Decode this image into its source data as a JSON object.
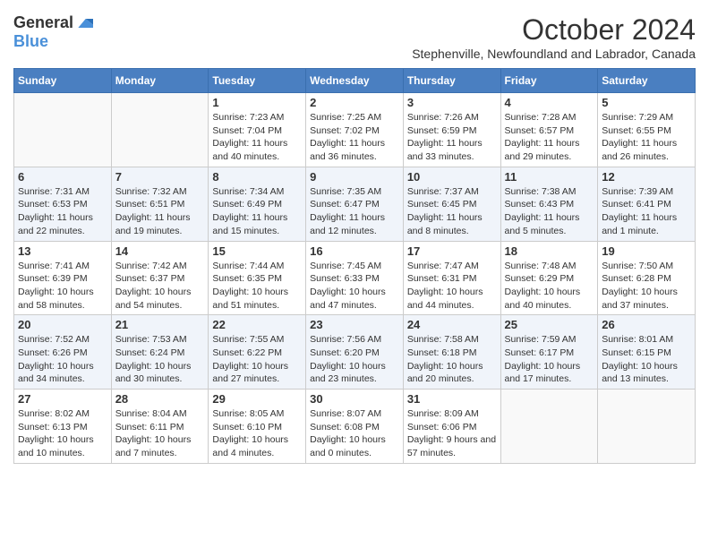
{
  "logo": {
    "general": "General",
    "blue": "Blue"
  },
  "title": "October 2024",
  "subtitle": "Stephenville, Newfoundland and Labrador, Canada",
  "weekdays": [
    "Sunday",
    "Monday",
    "Tuesday",
    "Wednesday",
    "Thursday",
    "Friday",
    "Saturday"
  ],
  "weeks": [
    [
      {
        "day": "",
        "sunrise": "",
        "sunset": "",
        "daylight": ""
      },
      {
        "day": "",
        "sunrise": "",
        "sunset": "",
        "daylight": ""
      },
      {
        "day": "1",
        "sunrise": "Sunrise: 7:23 AM",
        "sunset": "Sunset: 7:04 PM",
        "daylight": "Daylight: 11 hours and 40 minutes."
      },
      {
        "day": "2",
        "sunrise": "Sunrise: 7:25 AM",
        "sunset": "Sunset: 7:02 PM",
        "daylight": "Daylight: 11 hours and 36 minutes."
      },
      {
        "day": "3",
        "sunrise": "Sunrise: 7:26 AM",
        "sunset": "Sunset: 6:59 PM",
        "daylight": "Daylight: 11 hours and 33 minutes."
      },
      {
        "day": "4",
        "sunrise": "Sunrise: 7:28 AM",
        "sunset": "Sunset: 6:57 PM",
        "daylight": "Daylight: 11 hours and 29 minutes."
      },
      {
        "day": "5",
        "sunrise": "Sunrise: 7:29 AM",
        "sunset": "Sunset: 6:55 PM",
        "daylight": "Daylight: 11 hours and 26 minutes."
      }
    ],
    [
      {
        "day": "6",
        "sunrise": "Sunrise: 7:31 AM",
        "sunset": "Sunset: 6:53 PM",
        "daylight": "Daylight: 11 hours and 22 minutes."
      },
      {
        "day": "7",
        "sunrise": "Sunrise: 7:32 AM",
        "sunset": "Sunset: 6:51 PM",
        "daylight": "Daylight: 11 hours and 19 minutes."
      },
      {
        "day": "8",
        "sunrise": "Sunrise: 7:34 AM",
        "sunset": "Sunset: 6:49 PM",
        "daylight": "Daylight: 11 hours and 15 minutes."
      },
      {
        "day": "9",
        "sunrise": "Sunrise: 7:35 AM",
        "sunset": "Sunset: 6:47 PM",
        "daylight": "Daylight: 11 hours and 12 minutes."
      },
      {
        "day": "10",
        "sunrise": "Sunrise: 7:37 AM",
        "sunset": "Sunset: 6:45 PM",
        "daylight": "Daylight: 11 hours and 8 minutes."
      },
      {
        "day": "11",
        "sunrise": "Sunrise: 7:38 AM",
        "sunset": "Sunset: 6:43 PM",
        "daylight": "Daylight: 11 hours and 5 minutes."
      },
      {
        "day": "12",
        "sunrise": "Sunrise: 7:39 AM",
        "sunset": "Sunset: 6:41 PM",
        "daylight": "Daylight: 11 hours and 1 minute."
      }
    ],
    [
      {
        "day": "13",
        "sunrise": "Sunrise: 7:41 AM",
        "sunset": "Sunset: 6:39 PM",
        "daylight": "Daylight: 10 hours and 58 minutes."
      },
      {
        "day": "14",
        "sunrise": "Sunrise: 7:42 AM",
        "sunset": "Sunset: 6:37 PM",
        "daylight": "Daylight: 10 hours and 54 minutes."
      },
      {
        "day": "15",
        "sunrise": "Sunrise: 7:44 AM",
        "sunset": "Sunset: 6:35 PM",
        "daylight": "Daylight: 10 hours and 51 minutes."
      },
      {
        "day": "16",
        "sunrise": "Sunrise: 7:45 AM",
        "sunset": "Sunset: 6:33 PM",
        "daylight": "Daylight: 10 hours and 47 minutes."
      },
      {
        "day": "17",
        "sunrise": "Sunrise: 7:47 AM",
        "sunset": "Sunset: 6:31 PM",
        "daylight": "Daylight: 10 hours and 44 minutes."
      },
      {
        "day": "18",
        "sunrise": "Sunrise: 7:48 AM",
        "sunset": "Sunset: 6:29 PM",
        "daylight": "Daylight: 10 hours and 40 minutes."
      },
      {
        "day": "19",
        "sunrise": "Sunrise: 7:50 AM",
        "sunset": "Sunset: 6:28 PM",
        "daylight": "Daylight: 10 hours and 37 minutes."
      }
    ],
    [
      {
        "day": "20",
        "sunrise": "Sunrise: 7:52 AM",
        "sunset": "Sunset: 6:26 PM",
        "daylight": "Daylight: 10 hours and 34 minutes."
      },
      {
        "day": "21",
        "sunrise": "Sunrise: 7:53 AM",
        "sunset": "Sunset: 6:24 PM",
        "daylight": "Daylight: 10 hours and 30 minutes."
      },
      {
        "day": "22",
        "sunrise": "Sunrise: 7:55 AM",
        "sunset": "Sunset: 6:22 PM",
        "daylight": "Daylight: 10 hours and 27 minutes."
      },
      {
        "day": "23",
        "sunrise": "Sunrise: 7:56 AM",
        "sunset": "Sunset: 6:20 PM",
        "daylight": "Daylight: 10 hours and 23 minutes."
      },
      {
        "day": "24",
        "sunrise": "Sunrise: 7:58 AM",
        "sunset": "Sunset: 6:18 PM",
        "daylight": "Daylight: 10 hours and 20 minutes."
      },
      {
        "day": "25",
        "sunrise": "Sunrise: 7:59 AM",
        "sunset": "Sunset: 6:17 PM",
        "daylight": "Daylight: 10 hours and 17 minutes."
      },
      {
        "day": "26",
        "sunrise": "Sunrise: 8:01 AM",
        "sunset": "Sunset: 6:15 PM",
        "daylight": "Daylight: 10 hours and 13 minutes."
      }
    ],
    [
      {
        "day": "27",
        "sunrise": "Sunrise: 8:02 AM",
        "sunset": "Sunset: 6:13 PM",
        "daylight": "Daylight: 10 hours and 10 minutes."
      },
      {
        "day": "28",
        "sunrise": "Sunrise: 8:04 AM",
        "sunset": "Sunset: 6:11 PM",
        "daylight": "Daylight: 10 hours and 7 minutes."
      },
      {
        "day": "29",
        "sunrise": "Sunrise: 8:05 AM",
        "sunset": "Sunset: 6:10 PM",
        "daylight": "Daylight: 10 hours and 4 minutes."
      },
      {
        "day": "30",
        "sunrise": "Sunrise: 8:07 AM",
        "sunset": "Sunset: 6:08 PM",
        "daylight": "Daylight: 10 hours and 0 minutes."
      },
      {
        "day": "31",
        "sunrise": "Sunrise: 8:09 AM",
        "sunset": "Sunset: 6:06 PM",
        "daylight": "Daylight: 9 hours and 57 minutes."
      },
      {
        "day": "",
        "sunrise": "",
        "sunset": "",
        "daylight": ""
      },
      {
        "day": "",
        "sunrise": "",
        "sunset": "",
        "daylight": ""
      }
    ]
  ]
}
